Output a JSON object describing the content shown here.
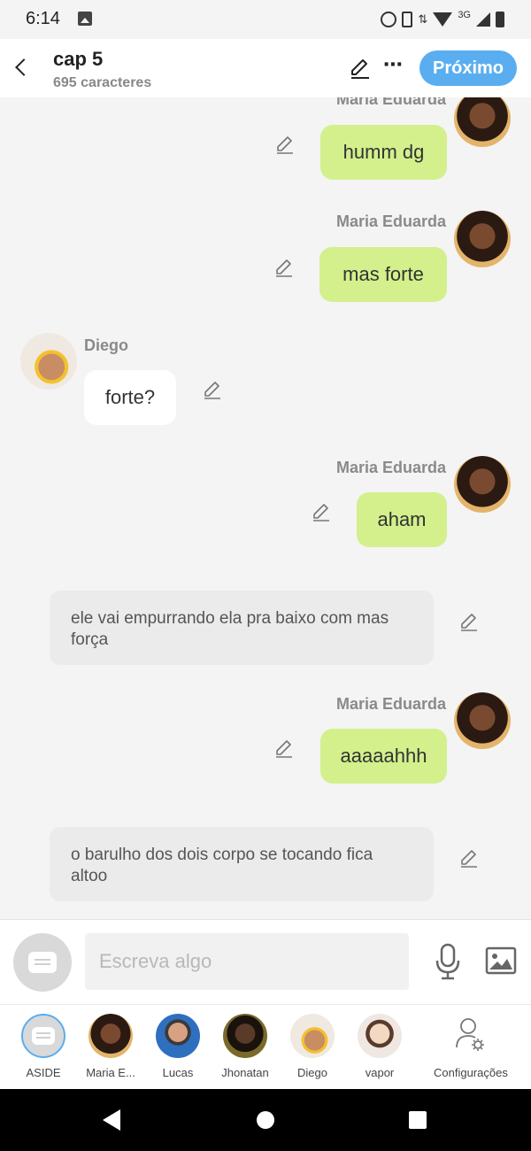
{
  "status_bar": {
    "time": "6:14",
    "network": "3G"
  },
  "header": {
    "title": "cap 5",
    "subtitle": "695 caracteres",
    "next_label": "Próximo",
    "more_label": "⋯"
  },
  "chat": {
    "messages": [
      {
        "type": "right",
        "sender": "Maria Eduarda",
        "text": "humm dg"
      },
      {
        "type": "right",
        "sender": "Maria Eduarda",
        "text": "mas forte"
      },
      {
        "type": "left",
        "sender": "Diego",
        "text": "forte?"
      },
      {
        "type": "right",
        "sender": "Maria Eduarda",
        "text": "aham"
      },
      {
        "type": "narration",
        "text": "ele vai empurrando ela pra baixo com mas força"
      },
      {
        "type": "right",
        "sender": "Maria Eduarda",
        "text": "aaaaahhh"
      },
      {
        "type": "narration",
        "text": "o barulho dos dois corpo se tocando fica altoo"
      }
    ]
  },
  "input": {
    "placeholder": "Escreva algo"
  },
  "tabs": [
    {
      "label": "ASIDE",
      "selected": true
    },
    {
      "label": "Maria E..."
    },
    {
      "label": "Lucas"
    },
    {
      "label": "Jhonatan"
    },
    {
      "label": "Diego"
    },
    {
      "label": "vapor"
    },
    {
      "label": "Configurações"
    }
  ],
  "colors": {
    "accent": "#5aaef0",
    "right_bubble": "#d3f08c",
    "left_bubble": "#ffffff",
    "narration": "#ebebeb"
  },
  "icons": [
    "back-icon",
    "pencil-icon",
    "more-icon",
    "aside-icon",
    "mic-icon",
    "image-icon",
    "settings-icon"
  ]
}
